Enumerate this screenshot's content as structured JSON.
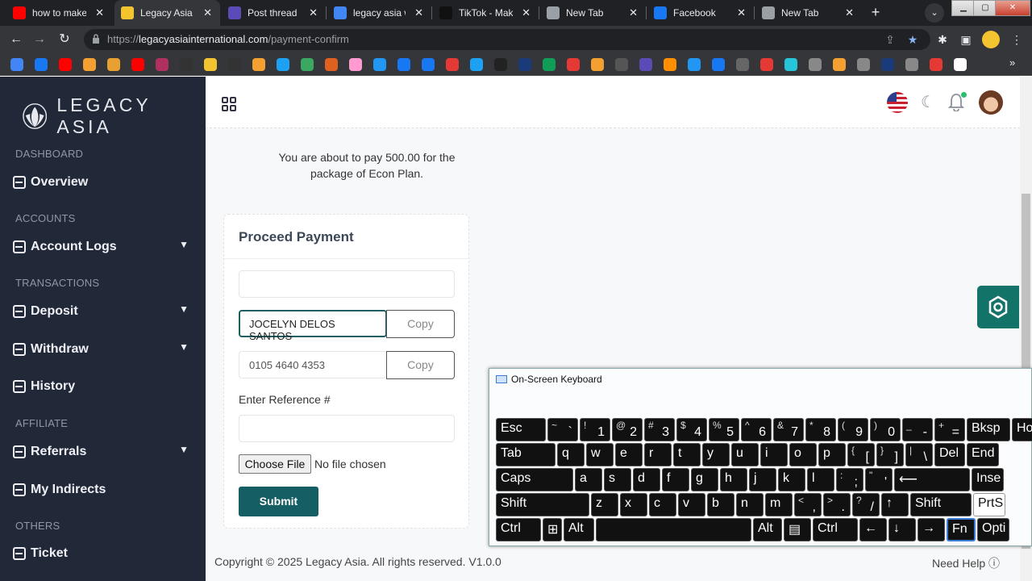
{
  "browser": {
    "tabs": [
      {
        "title": "how to make a",
        "icon": "youtube-icon",
        "color": "#ff0000",
        "active": false
      },
      {
        "title": "Legacy Asia",
        "icon": "warning-icon",
        "color": "#f4c430",
        "active": true
      },
      {
        "title": "Post thread | F",
        "icon": "shield-icon",
        "color": "#5b4bb7",
        "active": false
      },
      {
        "title": "legacy asia wh",
        "icon": "google-icon",
        "color": "#4285f4",
        "active": false
      },
      {
        "title": "TikTok - Make",
        "icon": "tiktok-icon",
        "color": "#111111",
        "active": false
      },
      {
        "title": "New Tab",
        "icon": "chrome-icon",
        "color": "#9aa0a6",
        "active": false
      },
      {
        "title": "Facebook",
        "icon": "facebook-icon",
        "color": "#1877f2",
        "active": false
      },
      {
        "title": "New Tab",
        "icon": "chrome-icon",
        "color": "#9aa0a6",
        "active": false
      }
    ],
    "url_scheme": "https://",
    "url_host": "legacyasiainternational.com",
    "url_path": "/payment-confirm",
    "bookmark_colors": [
      "#4285f4",
      "#1877f2",
      "#ff0000",
      "#f4a030",
      "#e8a030",
      "#ff0000",
      "#b03060",
      "#333333",
      "#f4c430",
      "#333333",
      "#f4a030",
      "#1da1f2",
      "#3aa860",
      "#e06020",
      "#ff9bd0",
      "#2196f3",
      "#1877f2",
      "#1877f2",
      "#e53935",
      "#1da1f2",
      "#222222",
      "#1a3a7a",
      "#0f9d58",
      "#e53935",
      "#f4a030",
      "#555555",
      "#5b4bb7",
      "#ff8f00",
      "#2196f3",
      "#1877f2",
      "#666666",
      "#e53935",
      "#26c6da",
      "#888888",
      "#f4a030",
      "#888888",
      "#1a3a7a",
      "#888888",
      "#e53935",
      "#ffffff"
    ]
  },
  "sidebar": {
    "brand": "LEGACY ASIA",
    "sections": [
      {
        "heading": "DASHBOARD",
        "items": [
          {
            "label": "Overview",
            "chevron": false
          }
        ]
      },
      {
        "heading": "ACCOUNTS",
        "items": [
          {
            "label": "Account Logs",
            "chevron": true
          }
        ]
      },
      {
        "heading": "TRANSACTIONS",
        "items": [
          {
            "label": "Deposit",
            "chevron": true
          },
          {
            "label": "Withdraw",
            "chevron": true
          },
          {
            "label": "History",
            "chevron": false
          }
        ]
      },
      {
        "heading": "AFFILIATE",
        "items": [
          {
            "label": "Referrals",
            "chevron": true
          },
          {
            "label": "My Indirects",
            "chevron": false
          }
        ]
      },
      {
        "heading": "OTHERS",
        "items": [
          {
            "label": "Ticket",
            "chevron": false
          }
        ]
      }
    ]
  },
  "main": {
    "pay_line1": "You are about to pay 500.00 for the",
    "pay_line2": "package of Econ Plan.",
    "card_title": "Proceed Payment",
    "account_name": "JOCELYN DELOS SANTOS",
    "account_number": "0105 4640 4353",
    "copy_label": "Copy",
    "reference_label": "Enter Reference #",
    "choose_file": "Choose File",
    "no_file": "No file chosen",
    "submit": "Submit",
    "copyright": "Copyright © 2025 Legacy Asia. All rights reserved. V1.0.0",
    "need_help": "Need Help"
  },
  "osk": {
    "title": "On-Screen Keyboard",
    "rows": [
      [
        {
          "p": "Esc"
        },
        {
          "s": "~",
          "p": "`"
        },
        {
          "s": "!",
          "p": "1"
        },
        {
          "s": "@",
          "p": "2"
        },
        {
          "s": "#",
          "p": "3"
        },
        {
          "s": "$",
          "p": "4"
        },
        {
          "s": "%",
          "p": "5"
        },
        {
          "s": "^",
          "p": "6"
        },
        {
          "s": "&",
          "p": "7"
        },
        {
          "s": "*",
          "p": "8"
        },
        {
          "s": "(",
          "p": "9"
        },
        {
          "s": ")",
          "p": "0"
        },
        {
          "s": "_",
          "p": "-"
        },
        {
          "s": "+",
          "p": "="
        },
        {
          "p": "Bksp"
        },
        {
          "p": "Hom"
        }
      ],
      [
        {
          "p": "Tab"
        },
        {
          "p": "q"
        },
        {
          "p": "w"
        },
        {
          "p": "e"
        },
        {
          "p": "r"
        },
        {
          "p": "t"
        },
        {
          "p": "y"
        },
        {
          "p": "u"
        },
        {
          "p": "i"
        },
        {
          "p": "o"
        },
        {
          "p": "p"
        },
        {
          "s": "{",
          "p": "["
        },
        {
          "s": "}",
          "p": "]"
        },
        {
          "s": "|",
          "p": "\\"
        },
        {
          "p": "Del"
        },
        {
          "p": "End"
        }
      ],
      [
        {
          "p": "Caps"
        },
        {
          "p": "a"
        },
        {
          "p": "s"
        },
        {
          "p": "d"
        },
        {
          "p": "f"
        },
        {
          "p": "g"
        },
        {
          "p": "h"
        },
        {
          "p": "j"
        },
        {
          "p": "k"
        },
        {
          "p": "l"
        },
        {
          "s": ":",
          "p": ";"
        },
        {
          "s": "\"",
          "p": "'"
        },
        {
          "p": "⟵"
        },
        {
          "p": "Inse"
        }
      ],
      [
        {
          "p": "Shift"
        },
        {
          "p": "z"
        },
        {
          "p": "x"
        },
        {
          "p": "c"
        },
        {
          "p": "v"
        },
        {
          "p": "b"
        },
        {
          "p": "n"
        },
        {
          "p": "m"
        },
        {
          "s": "<",
          "p": ","
        },
        {
          "s": ">",
          "p": "."
        },
        {
          "s": "?",
          "p": "/"
        },
        {
          "p": "↑"
        },
        {
          "p": "Shift"
        },
        {
          "p": "PrtS"
        }
      ],
      [
        {
          "p": "Ctrl"
        },
        {
          "p": "⊞"
        },
        {
          "p": "Alt"
        },
        {
          "p": ""
        },
        {
          "p": "Alt"
        },
        {
          "p": "▤"
        },
        {
          "p": "Ctrl"
        },
        {
          "p": "←"
        },
        {
          "p": "↓"
        },
        {
          "p": "→"
        },
        {
          "p": "Fn"
        },
        {
          "p": "Opti"
        }
      ]
    ]
  }
}
